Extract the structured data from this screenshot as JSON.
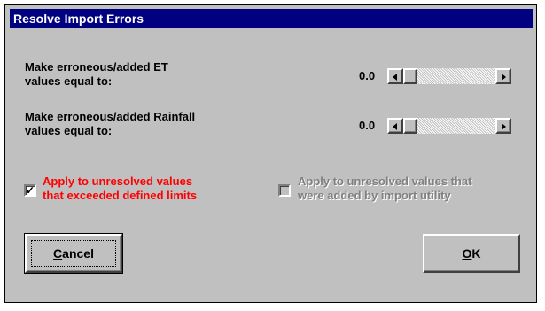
{
  "window": {
    "title": "Resolve Import Errors"
  },
  "settings": [
    {
      "label_line1": "Make erroneous/added ET",
      "label_line2": "values equal to:",
      "value": "0.0"
    },
    {
      "label_line1": "Make erroneous/added Rainfall",
      "label_line2": "values equal to:",
      "value": "0.0"
    }
  ],
  "options": {
    "exceeded": {
      "line1": "Apply to unresolved values",
      "line2": "that exceeded defined limits",
      "checked": true,
      "mark": "✓",
      "color": "#ff0000"
    },
    "added": {
      "line1": "Apply to unresolved values that",
      "line2": "were added by import utility",
      "checked": false,
      "disabled": true,
      "color": "#808080"
    }
  },
  "buttons": {
    "cancel": {
      "accel": "C",
      "rest": "ancel"
    },
    "ok": {
      "accel": "O",
      "rest": "K"
    }
  },
  "icons": {
    "scroll_left": "arrow-left-icon",
    "scroll_right": "arrow-right-icon"
  }
}
